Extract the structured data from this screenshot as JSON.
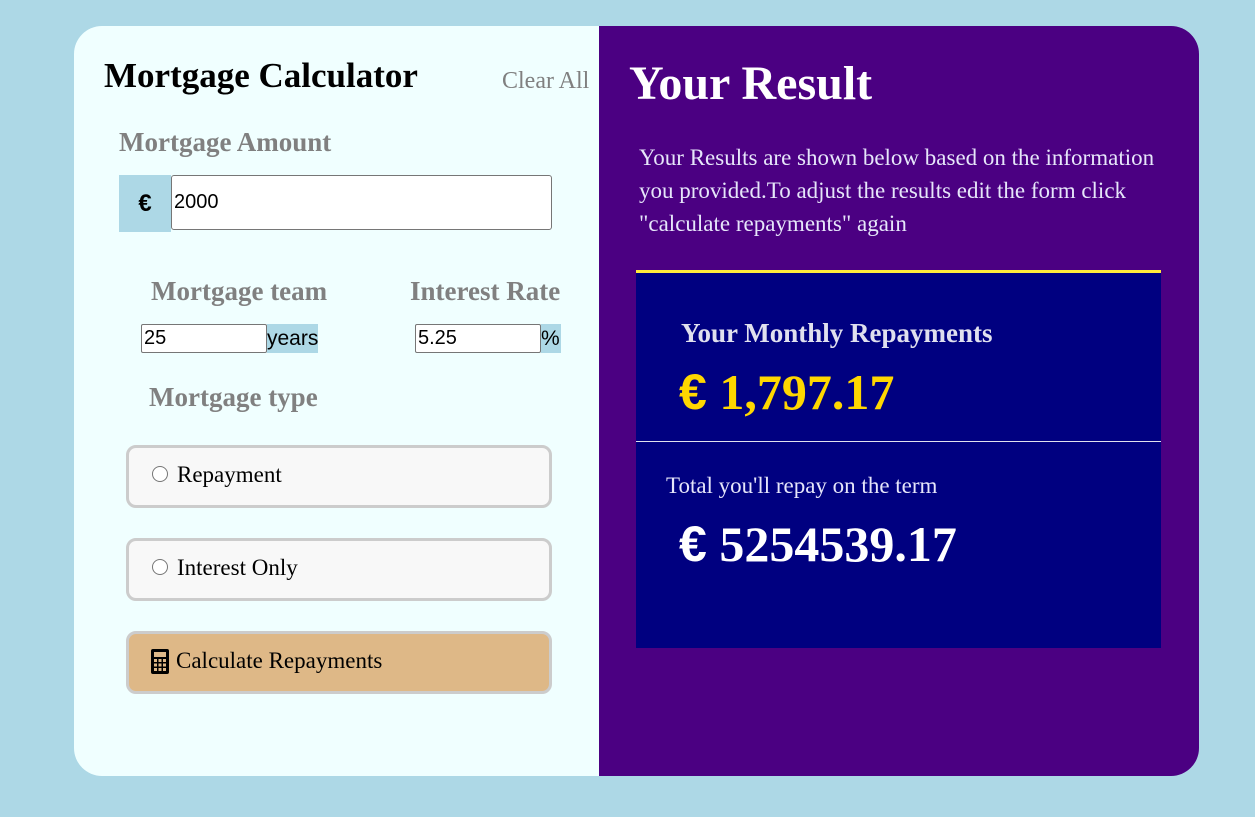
{
  "form": {
    "title": "Mortgage Calculator",
    "clear_all": "Clear All",
    "amount": {
      "label": "Mortgage Amount",
      "currency": "€",
      "value": "2000"
    },
    "term": {
      "label": "Mortgage team",
      "value": "25",
      "suffix": "years"
    },
    "rate": {
      "label": "Interest Rate",
      "value": "5.25",
      "suffix": "%"
    },
    "type": {
      "label": "Mortgage type",
      "options": [
        {
          "label": "Repayment",
          "selected": false
        },
        {
          "label": "Interest Only",
          "selected": false
        }
      ]
    },
    "submit": {
      "label": "Calculate Repayments",
      "icon": "calculator-icon"
    }
  },
  "result": {
    "title": "Your Result",
    "description": "Your Results are shown below based on the information you provided.To adjust the results edit the form click \"calculate repayments\" again",
    "monthly": {
      "label": "Your Monthly Repayments",
      "currency": "€",
      "value": "1,797.17"
    },
    "total": {
      "label": "Total you'll repay on the term",
      "currency": "€",
      "value": "5254539.17"
    }
  },
  "colors": {
    "page_bg": "#add8e6",
    "form_bg": "#f0ffff",
    "result_bg": "#4b0082",
    "result_box_bg": "#000080",
    "accent_yellow": "#ffd700",
    "button_bg": "#deb887"
  }
}
